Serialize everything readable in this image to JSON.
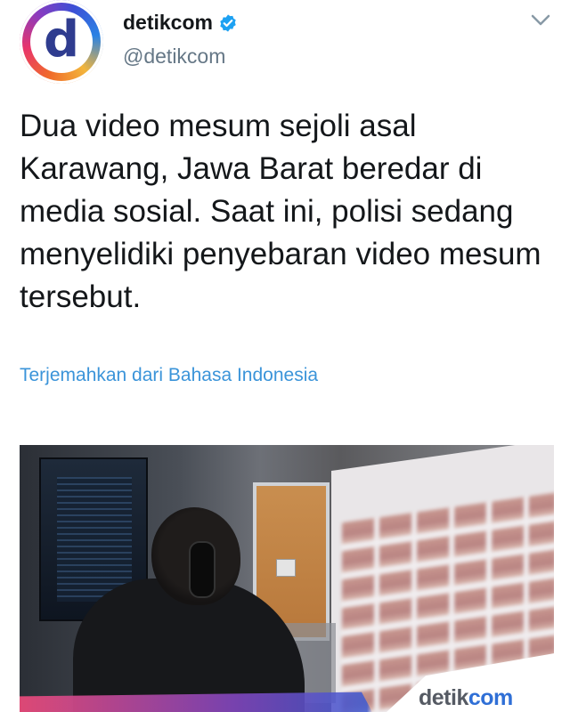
{
  "profile": {
    "name": "detikcom",
    "handle": "@detikcom",
    "avatar_letter": "d",
    "verified": true
  },
  "tweet": {
    "text": "Dua video mesum sejoli asal Karawang, Jawa Barat beredar di media sosial. Saat ini, polisi sedang menyelidiki penyebaran video mesum tersebut.",
    "translate_link": "Terjemahkan dari Bahasa Indonesia"
  },
  "media": {
    "watermark_prefix": "detik",
    "watermark_suffix": "com"
  },
  "icons": {
    "verified": "verified-badge-icon",
    "menu": "chevron-down-icon"
  },
  "colors": {
    "handle": "#657786",
    "link": "#3b94d9",
    "verified": "#1da1f2"
  }
}
